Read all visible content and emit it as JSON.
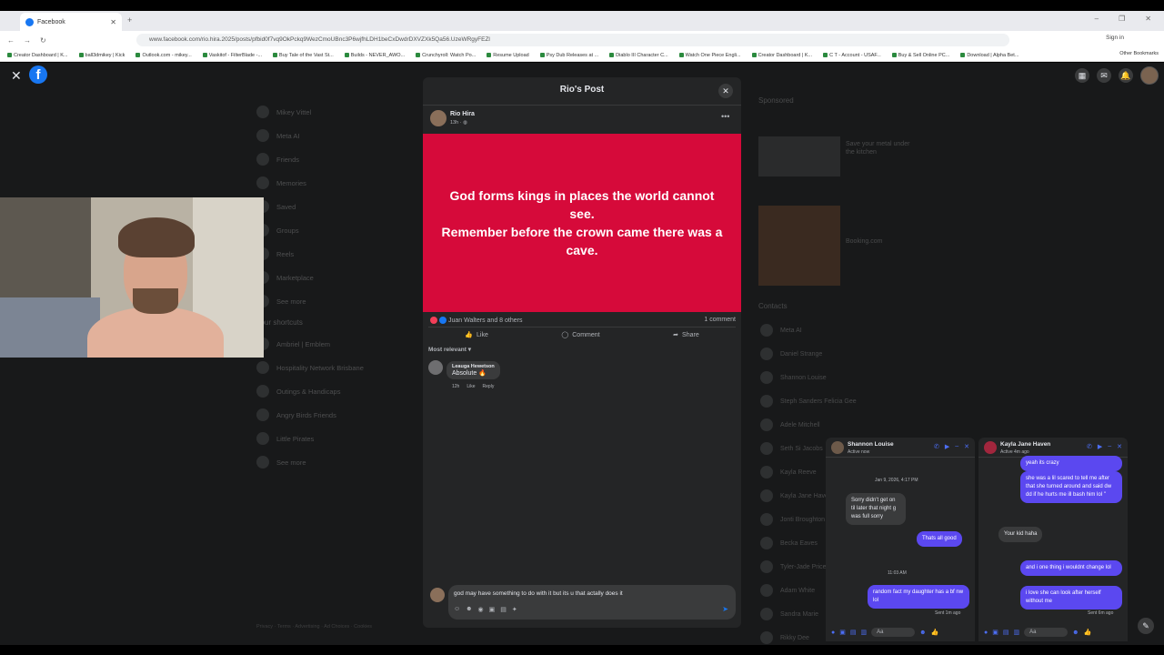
{
  "browser": {
    "tab_title": "Facebook",
    "url": "www.facebook.com/rio.hira.2025/posts/pfbid0f7vq9OkPckq9WezCmoUBnc3P6wjfhLDH1beCxDwdrDXVZXk5Qa56.UzeWRgyFEZl",
    "sign_in_label": "Sign in",
    "other_bookmarks": "Other Bookmarks",
    "bookmarks": [
      "Creator Dashboard | K...",
      "ball3dmikey | Kick",
      "Outlook.com - mikey...",
      "Vaskitof - FilterBlade -...",
      "Buy Tale of the Vast St...",
      "Builds - NEVER_AWO...",
      "Crunchyroll: Watch Po...",
      "Resume Upload",
      "Psy Dub Releases at ...",
      "Diablo III Character C...",
      "Watch One Piece Engli...",
      "Creator Dashboard | K...",
      "C T - Account - USAF...",
      "Buy & Sell Online PC...",
      "Download | Alpha Bet..."
    ]
  },
  "fb": {
    "logo": "f",
    "sidebar": [
      "Mikey Vittel",
      "Meta AI",
      "Friends",
      "Memories",
      "Saved",
      "Groups",
      "Reels",
      "Marketplace",
      "See more"
    ],
    "shortcuts_header": "Your shortcuts",
    "shortcuts": [
      "Ambriel | Emblem",
      "Hospitality Network Brisbane",
      "Outings & Handicaps",
      "Angry Birds Friends",
      "Little Pirates",
      "See more"
    ],
    "sponsored": "Sponsored",
    "ad1": "Save your metal under the kitchen",
    "ad2": "Booking.com",
    "contacts_header": "Contacts",
    "contacts": [
      "Meta AI",
      "Daniel Strange",
      "Shannon Louise",
      "Steph Sanders Felicia Gee",
      "Adele Mitchell",
      "Seth Si Jacobs",
      "Kayla Reeve",
      "Kayla Jane Haven",
      "Jonti Broughton",
      "Becka Eaves",
      "Tyler-Jade Price",
      "Adam White",
      "Sandra Marie",
      "Rikky Dee"
    ],
    "footer": "Privacy · Terms · Advertising · Ad Choices · Cookies"
  },
  "post": {
    "modal_title": "Rio's Post",
    "author": "Rio Hira",
    "time": "13h · ◍",
    "image_line1": "God forms kings in places the world cannot see.",
    "image_line2": "Remember before the crown came there was a cave.",
    "reactions": "Juan Walters and 8 others",
    "comment_count": "1 comment",
    "like": "Like",
    "comment": "Comment",
    "share": "Share",
    "most_relevant": "Most relevant ▾",
    "comment1": {
      "name": "Leauga Hewetson",
      "text": "Absolute 🔥",
      "time": "12h",
      "like": "Like",
      "reply": "Reply"
    },
    "compose_text": "god may have something to do with it but its u that actally does it"
  },
  "chat1": {
    "name": "Shannon Louise",
    "status": "Active now",
    "date": "Jan 9, 2026, 4:17 PM",
    "msg1": "Sorry didn't get on til later that night g was full sorry",
    "msg2": "Thats all good",
    "time2": "11:03 AM",
    "msg3": "random fact my daughter has a bf nw lol",
    "sent": "Sent 1m ago",
    "input": "Aa"
  },
  "chat2": {
    "name": "Kayla Jane Haven",
    "status": "Active 4m ago",
    "msg0": "yeah its crazy",
    "msg1": "she was a lil scared to tell me after that she turned around and said dw dd if he hurts me ill bash him lol \"",
    "msg2": "Your kid haha",
    "msg3": "and i one thing i wouldnt change lol",
    "msg4": "i love she can look after herself without me",
    "sent": "Sent 6m ago",
    "input": "Aa"
  },
  "colors": {
    "post_bg": "#d60a3a",
    "fb_blue": "#1877f2",
    "messenger_purple": "#5b48f0"
  }
}
